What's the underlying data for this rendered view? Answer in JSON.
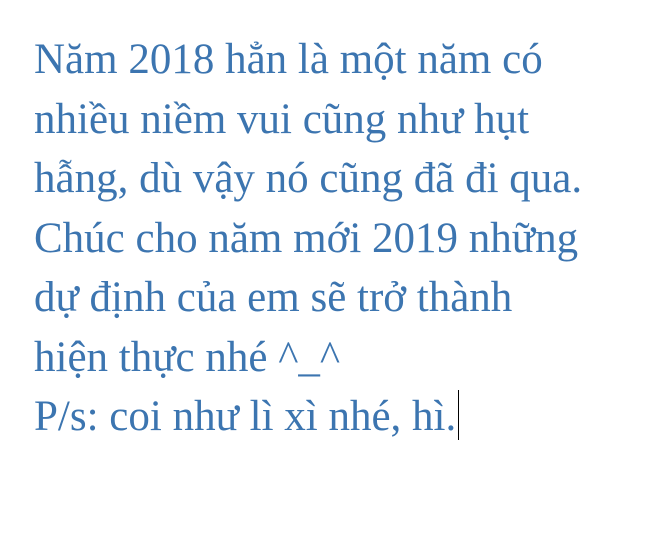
{
  "document": {
    "paragraph1": [
      "Năm 2018 hẳn là một năm có",
      "nhiều niềm vui cũng như hụt",
      "hẫng, dù vậy nó cũng đã đi qua.",
      "Chúc cho năm mới 2019 những",
      "dự định của em sẽ trở thành",
      "hiện thực nhé ^_^"
    ],
    "paragraph2": "P/s: coi như lì xì nhé, hì.",
    "text_color": "#3c75b0"
  }
}
